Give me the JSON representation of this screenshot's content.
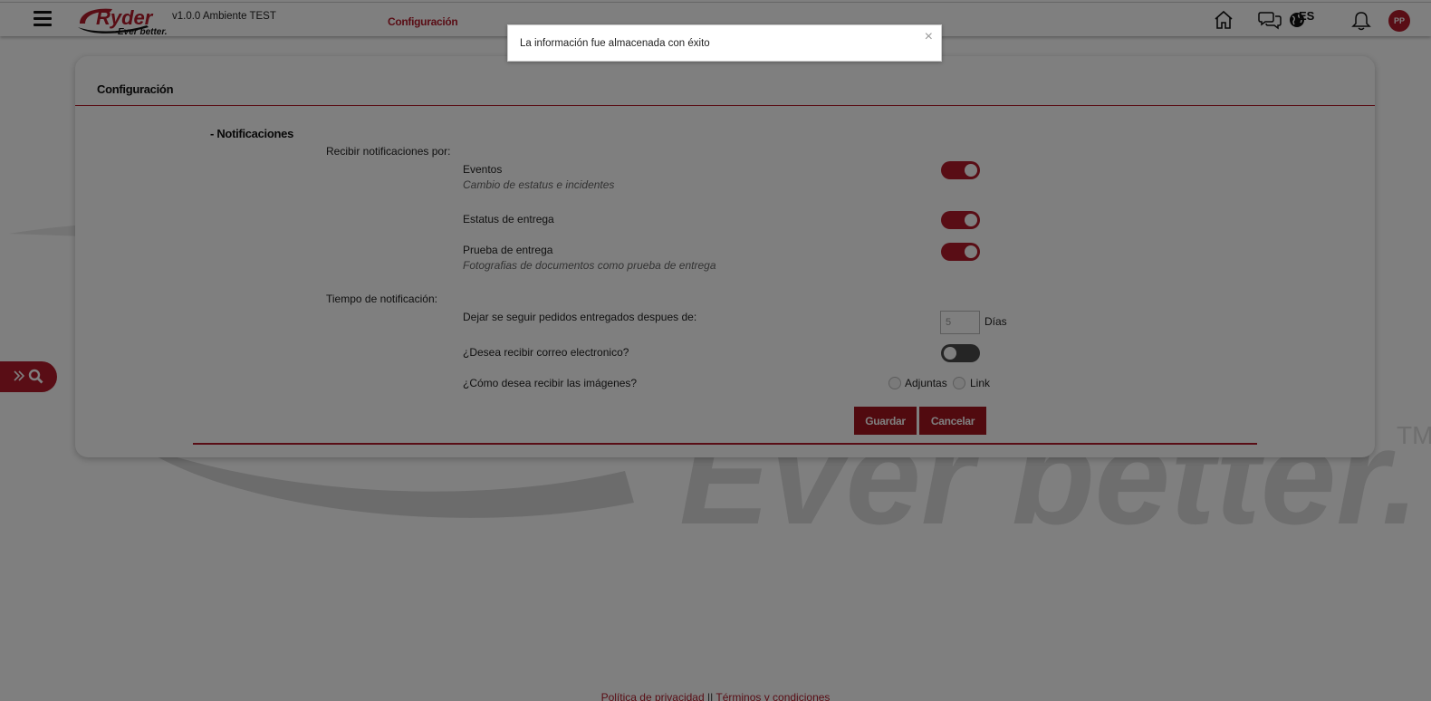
{
  "header": {
    "logo_text": "Ryder",
    "logo_tagline": "Ever better.",
    "version": "v1.0.0 Ambiente TEST",
    "active_nav": "Configuración",
    "language": "ES",
    "avatar_initials": "PP",
    "icons": [
      "menu-icon",
      "home-icon",
      "chat-icon",
      "globe-icon",
      "bell-icon"
    ]
  },
  "toast": {
    "message": "La información fue almacenada con éxito",
    "close": "×"
  },
  "card": {
    "title": "Configuración",
    "section": "- Notificaciones",
    "receive_label": "Recibir notificaciones por:",
    "options": [
      {
        "label": "Eventos",
        "description": "Cambio de estatus e incidentes",
        "enabled": true
      },
      {
        "label": "Estatus de entrega",
        "description": "",
        "enabled": true
      },
      {
        "label": "Prueba de entrega",
        "description": "Fotografias de documentos como prueba de entrega",
        "enabled": true
      }
    ],
    "time_label": "Tiempo de notificación:",
    "stop_tracking_label": "Dejar se seguir pedidos entregados despues de:",
    "days_value": "5",
    "days_unit": "Días",
    "email_label": "¿Desea recibir correo electronico?",
    "email_enabled": false,
    "images_label": "¿Cómo desea recibir las imágenes?",
    "image_options": [
      "Adjuntas",
      "Link"
    ],
    "save_button": "Guardar",
    "cancel_button": "Cancelar"
  },
  "footer": {
    "privacy": "Política de privacidad",
    "separator": "||",
    "terms": "Términos y condiciones"
  },
  "colors": {
    "brand_red": "#b31b2a",
    "button_red": "#a3141f"
  }
}
